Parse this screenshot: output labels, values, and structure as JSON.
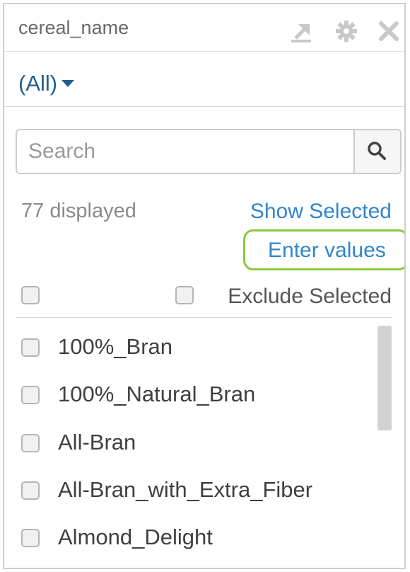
{
  "filter": {
    "title": "cereal_name",
    "header_icons": [
      "export-icon",
      "gear-icon",
      "close-icon"
    ],
    "selected_value": "(All)",
    "search": {
      "placeholder": "Search",
      "value": ""
    },
    "count_text": "77 displayed",
    "show_selected_label": "Show Selected",
    "enter_values_label": "Enter values",
    "exclude_selected_label": "Exclude Selected",
    "items": [
      {
        "label": "100%_Bran",
        "checked": false
      },
      {
        "label": "100%_Natural_Bran",
        "checked": false
      },
      {
        "label": "All-Bran",
        "checked": false
      },
      {
        "label": "All-Bran_with_Extra_Fiber",
        "checked": false
      },
      {
        "label": "Almond_Delight",
        "checked": false
      }
    ]
  },
  "colors": {
    "link": "#2f86cc",
    "selected_value": "#1f5f8e",
    "highlight_border": "#8cc63f",
    "header_icon": "#c8c8c8"
  }
}
